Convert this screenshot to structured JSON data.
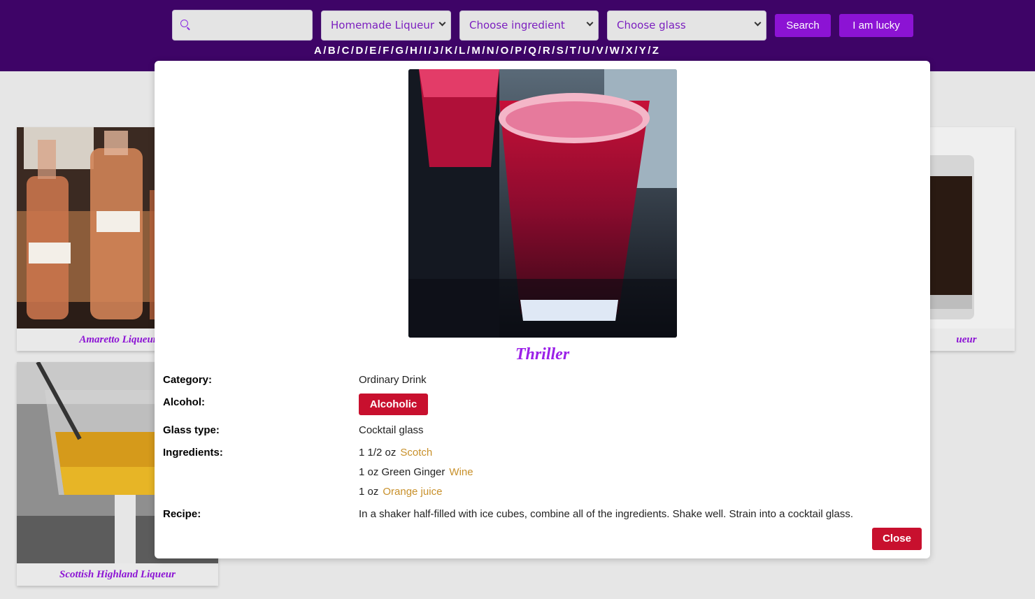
{
  "header": {
    "search": {
      "value": "",
      "placeholder": ""
    },
    "category_select": {
      "selected": "Homemade Liqueur"
    },
    "ingredient_select": {
      "selected": "Choose ingredient"
    },
    "glass_select": {
      "selected": "Choose glass"
    },
    "search_button": "Search",
    "lucky_button": "I am lucky",
    "letters": [
      "A",
      "B",
      "C",
      "D",
      "E",
      "F",
      "G",
      "H",
      "I",
      "J",
      "K",
      "L",
      "M",
      "N",
      "O",
      "P",
      "Q",
      "R",
      "S",
      "T",
      "U",
      "V",
      "W",
      "X",
      "Y",
      "Z"
    ],
    "separator": "/"
  },
  "cards": [
    {
      "name": "Amaretto Liqueur"
    },
    {
      "name": "Scottish Highland Liqueur"
    },
    {
      "name": "ueur"
    }
  ],
  "modal": {
    "title": "Thriller",
    "category_label": "Category:",
    "category_value": "Ordinary Drink",
    "alcohol_label": "Alcohol:",
    "alcohol_value": "Alcoholic",
    "glass_label": "Glass type:",
    "glass_value": "Cocktail glass",
    "ingredients_label": "Ingredients:",
    "ingredients": [
      {
        "measure": "1 1/2 oz",
        "name": "Scotch"
      },
      {
        "measure": "1 oz Green Ginger",
        "name": "Wine"
      },
      {
        "measure": "1 oz",
        "name": "Orange juice"
      }
    ],
    "recipe_label": "Recipe:",
    "recipe_value": "In a shaker half-filled with ice cubes, combine all of the ingredients. Shake well. Strain into a cocktail glass.",
    "close_button": "Close"
  },
  "colors": {
    "header_bg": "#3e0467",
    "accent_purple": "#8c13d4",
    "title_purple": "#9b20e8",
    "danger_red": "#c8102e",
    "ingredient_link": "#c8902a"
  }
}
